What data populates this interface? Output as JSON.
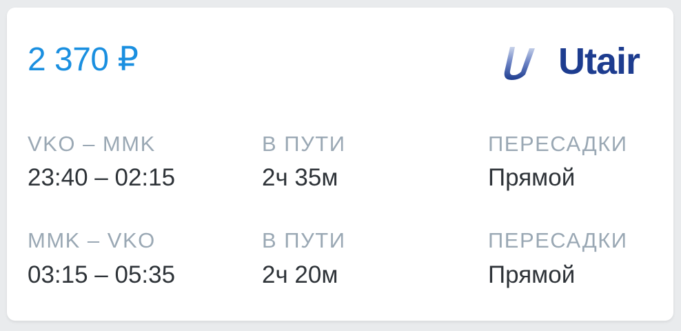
{
  "price": "2 370 ₽",
  "airline": {
    "name": "Utair",
    "logo_icon": "utair-swoosh-icon",
    "brand_color": "#1d3c8f"
  },
  "accent_color": "#1a8fe0",
  "segments": [
    {
      "route": "VKO – MMK",
      "times": "23:40 – 02:15",
      "duration_label": "В ПУТИ",
      "duration": "2ч 35м",
      "transfers_label": "ПЕРЕСАДКИ",
      "transfers": "Прямой"
    },
    {
      "route": "MMK – VKO",
      "times": "03:15 – 05:35",
      "duration_label": "В ПУТИ",
      "duration": "2ч 20м",
      "transfers_label": "ПЕРЕСАДКИ",
      "transfers": "Прямой"
    }
  ]
}
